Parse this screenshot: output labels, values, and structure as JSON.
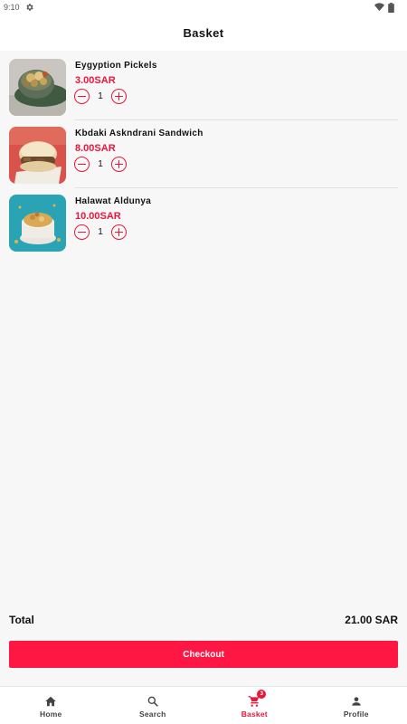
{
  "status_bar": {
    "time": "9:10",
    "icons": [
      "settings-gear-icon",
      "wifi-icon",
      "battery-icon"
    ]
  },
  "header": {
    "title": "Basket"
  },
  "basket": {
    "items": [
      {
        "name": "Eygyption Pickels",
        "price": "3.00SAR",
        "quantity": "1",
        "image": "pickles-bowl-photo"
      },
      {
        "name": "Kbdaki Askndrani Sandwich",
        "price": "8.00SAR",
        "quantity": "1",
        "image": "sandwich-photo"
      },
      {
        "name": "Halawat Aldunya",
        "price": "10.00SAR",
        "quantity": "1",
        "image": "dessert-photo"
      }
    ]
  },
  "summary": {
    "total_label": "Total",
    "total_value": "21.00 SAR",
    "checkout_label": "Checkout"
  },
  "nav": {
    "items": [
      {
        "label": "Home",
        "icon": "home-icon"
      },
      {
        "label": "Search",
        "icon": "search-icon"
      },
      {
        "label": "Basket",
        "icon": "cart-icon",
        "badge": "3",
        "active": true
      },
      {
        "label": "Profile",
        "icon": "person-icon"
      }
    ]
  },
  "colors": {
    "accent": "#e8173b",
    "checkout_button": "#ff1744",
    "background": "#f7f7f7"
  }
}
